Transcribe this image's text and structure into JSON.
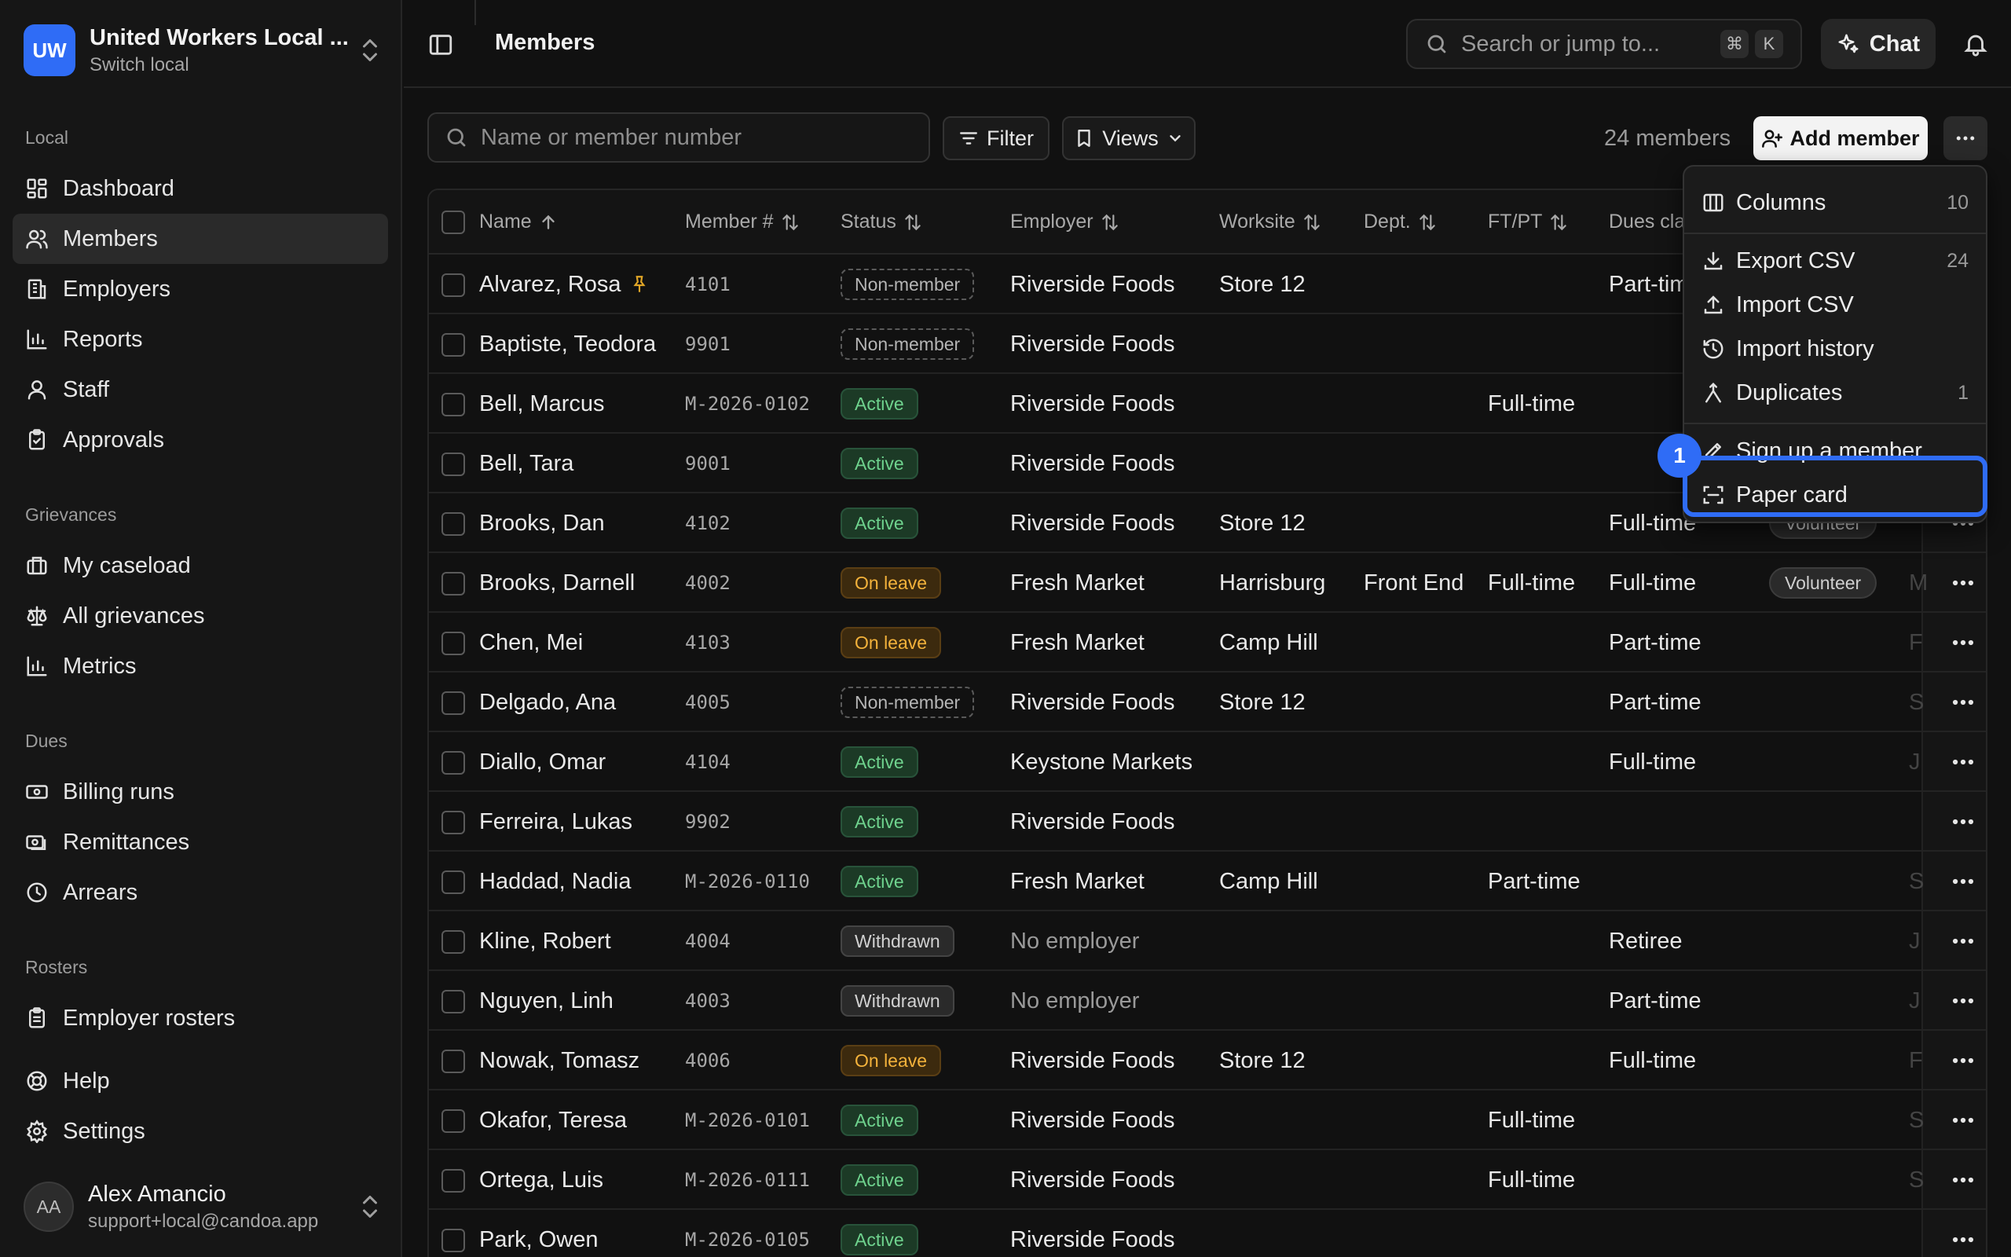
{
  "org": {
    "initials": "UW",
    "name": "United Workers Local ...",
    "subtitle": "Switch local"
  },
  "sidebar": {
    "sections": [
      {
        "title": "Local"
      },
      {
        "title": "Grievances"
      },
      {
        "title": "Dues"
      },
      {
        "title": "Rosters"
      }
    ],
    "items": [
      {
        "label": "Dashboard",
        "icon": "dashboard-icon"
      },
      {
        "label": "Members",
        "icon": "users-icon",
        "active": true
      },
      {
        "label": "Employers",
        "icon": "building-icon"
      },
      {
        "label": "Reports",
        "icon": "bar-chart-icon"
      },
      {
        "label": "Staff",
        "icon": "person-icon"
      },
      {
        "label": "Approvals",
        "icon": "clipboard-check-icon"
      },
      {
        "label": "My caseload",
        "icon": "briefcase-icon"
      },
      {
        "label": "All grievances",
        "icon": "scales-icon"
      },
      {
        "label": "Metrics",
        "icon": "bar-chart-icon"
      },
      {
        "label": "Billing runs",
        "icon": "billing-icon"
      },
      {
        "label": "Remittances",
        "icon": "remittance-icon"
      },
      {
        "label": "Arrears",
        "icon": "clock-icon"
      },
      {
        "label": "Employer rosters",
        "icon": "clipboard-list-icon"
      },
      {
        "label": "Help",
        "icon": "lifebuoy-icon"
      },
      {
        "label": "Settings",
        "icon": "gear-icon"
      }
    ]
  },
  "user": {
    "initials": "AA",
    "name": "Alex Amancio",
    "email": "support+local@candoa.app"
  },
  "topbar": {
    "title": "Members",
    "search_placeholder": "Search or jump to...",
    "kbd_cmd": "⌘",
    "kbd_k": "K",
    "chat_label": "Chat"
  },
  "toolbar": {
    "search_placeholder": "Name or member number",
    "filter_label": "Filter",
    "views_label": "Views",
    "member_count": "24 members",
    "add_member_label": "Add member"
  },
  "table": {
    "headers": [
      "Name",
      "Member #",
      "Status",
      "Employer",
      "Worksite",
      "Dept.",
      "FT/PT",
      "Dues cla"
    ],
    "rows": [
      {
        "name": "Alvarez, Rosa",
        "pinned": true,
        "number": "4101",
        "status": "Non-member",
        "status_kind": "nonmember",
        "employer": "Riverside Foods",
        "worksite": "Store 12",
        "dept": "",
        "ftpt": "",
        "dues": "Part-tim",
        "tag": "",
        "extra": ""
      },
      {
        "name": "Baptiste, Teodora",
        "number": "9901",
        "status": "Non-member",
        "status_kind": "nonmember",
        "employer": "Riverside Foods",
        "worksite": "",
        "dept": "",
        "ftpt": "",
        "dues": "",
        "tag": "",
        "extra": ""
      },
      {
        "name": "Bell, Marcus",
        "number": "M-2026-0102",
        "status": "Active",
        "status_kind": "active",
        "employer": "Riverside Foods",
        "worksite": "",
        "dept": "",
        "ftpt": "Full-time",
        "dues": "",
        "tag": "",
        "extra": ""
      },
      {
        "name": "Bell, Tara",
        "number": "9001",
        "status": "Active",
        "status_kind": "active",
        "employer": "Riverside Foods",
        "worksite": "",
        "dept": "",
        "ftpt": "",
        "dues": "",
        "tag": "",
        "extra": ""
      },
      {
        "name": "Brooks, Dan",
        "number": "4102",
        "status": "Active",
        "status_kind": "active",
        "employer": "Riverside Foods",
        "worksite": "Store 12",
        "dept": "",
        "ftpt": "",
        "dues": "Full-time",
        "tag": "Volunteer",
        "extra": ""
      },
      {
        "name": "Brooks, Darnell",
        "number": "4002",
        "status": "On leave",
        "status_kind": "leave",
        "employer": "Fresh Market",
        "worksite": "Harrisburg",
        "dept": "Front End",
        "ftpt": "Full-time",
        "dues": "Full-time",
        "tag": "Volunteer",
        "extra": "M"
      },
      {
        "name": "Chen, Mei",
        "number": "4103",
        "status": "On leave",
        "status_kind": "leave",
        "employer": "Fresh Market",
        "worksite": "Camp Hill",
        "dept": "",
        "ftpt": "",
        "dues": "Part-time",
        "tag": "",
        "extra": "F"
      },
      {
        "name": "Delgado, Ana",
        "number": "4005",
        "status": "Non-member",
        "status_kind": "nonmember",
        "employer": "Riverside Foods",
        "worksite": "Store 12",
        "dept": "",
        "ftpt": "",
        "dues": "Part-time",
        "tag": "",
        "extra": "S"
      },
      {
        "name": "Diallo, Omar",
        "number": "4104",
        "status": "Active",
        "status_kind": "active",
        "employer": "Keystone Markets",
        "worksite": "",
        "dept": "",
        "ftpt": "",
        "dues": "Full-time",
        "tag": "",
        "extra": "J"
      },
      {
        "name": "Ferreira, Lukas",
        "number": "9902",
        "status": "Active",
        "status_kind": "active",
        "employer": "Riverside Foods",
        "worksite": "",
        "dept": "",
        "ftpt": "",
        "dues": "",
        "tag": "",
        "extra": ""
      },
      {
        "name": "Haddad, Nadia",
        "number": "M-2026-0110",
        "status": "Active",
        "status_kind": "active",
        "employer": "Fresh Market",
        "worksite": "Camp Hill",
        "dept": "",
        "ftpt": "Part-time",
        "dues": "",
        "tag": "",
        "extra": "S"
      },
      {
        "name": "Kline, Robert",
        "number": "4004",
        "status": "Withdrawn",
        "status_kind": "withdrawn",
        "employer": "No employer",
        "employer_muted": true,
        "worksite": "",
        "dept": "",
        "ftpt": "",
        "dues": "Retiree",
        "tag": "",
        "extra": "J"
      },
      {
        "name": "Nguyen, Linh",
        "number": "4003",
        "status": "Withdrawn",
        "status_kind": "withdrawn",
        "employer": "No employer",
        "employer_muted": true,
        "worksite": "",
        "dept": "",
        "ftpt": "",
        "dues": "Part-time",
        "tag": "",
        "extra": "J"
      },
      {
        "name": "Nowak, Tomasz",
        "number": "4006",
        "status": "On leave",
        "status_kind": "leave",
        "employer": "Riverside Foods",
        "worksite": "Store 12",
        "dept": "",
        "ftpt": "",
        "dues": "Full-time",
        "tag": "",
        "extra": "F"
      },
      {
        "name": "Okafor, Teresa",
        "number": "M-2026-0101",
        "status": "Active",
        "status_kind": "active",
        "employer": "Riverside Foods",
        "worksite": "",
        "dept": "",
        "ftpt": "Full-time",
        "dues": "",
        "tag": "",
        "extra": "S"
      },
      {
        "name": "Ortega, Luis",
        "number": "M-2026-0111",
        "status": "Active",
        "status_kind": "active",
        "employer": "Riverside Foods",
        "worksite": "",
        "dept": "",
        "ftpt": "Full-time",
        "dues": "",
        "tag": "",
        "extra": "S"
      },
      {
        "name": "Park, Owen",
        "number": "M-2026-0105",
        "status": "Active",
        "status_kind": "active",
        "employer": "Riverside Foods",
        "worksite": "",
        "dept": "",
        "ftpt": "",
        "dues": "",
        "tag": "",
        "extra": ""
      }
    ]
  },
  "menu": {
    "items": [
      {
        "label": "Columns",
        "count": "10",
        "icon": "columns-icon"
      },
      {
        "label": "Export CSV",
        "count": "24",
        "icon": "download-icon"
      },
      {
        "label": "Import CSV",
        "count": "",
        "icon": "upload-icon"
      },
      {
        "label": "Import history",
        "count": "",
        "icon": "history-icon"
      },
      {
        "label": "Duplicates",
        "count": "1",
        "icon": "merge-icon"
      },
      {
        "label": "Sign up a member",
        "count": "",
        "icon": "pen-icon"
      },
      {
        "label": "Paper card",
        "count": "",
        "icon": "scan-icon"
      }
    ],
    "step_number": "1"
  },
  "colors": {
    "accent": "#2f6cf6",
    "background": "#111111",
    "active_green": "#6fd38e",
    "leave_amber": "#f3b23b"
  }
}
